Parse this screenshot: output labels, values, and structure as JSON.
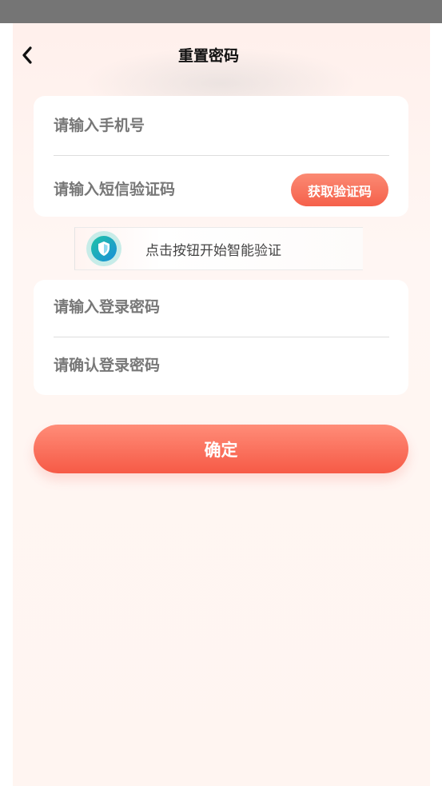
{
  "header": {
    "title": "重置密码",
    "back_icon": "chevron-left-icon"
  },
  "phone_form": {
    "phone_placeholder": "请输入手机号",
    "sms_code_placeholder": "请输入短信验证码",
    "get_code_label": "获取验证码"
  },
  "captcha": {
    "icon": "shield-icon",
    "label": "点击按钮开始智能验证"
  },
  "password_form": {
    "password_placeholder": "请输入登录密码",
    "confirm_password_placeholder": "请确认登录密码"
  },
  "confirm_button": {
    "label": "确定"
  },
  "colors": {
    "accent": "#f65a46",
    "status_bar": "#757575",
    "background": "#fff5f1"
  }
}
